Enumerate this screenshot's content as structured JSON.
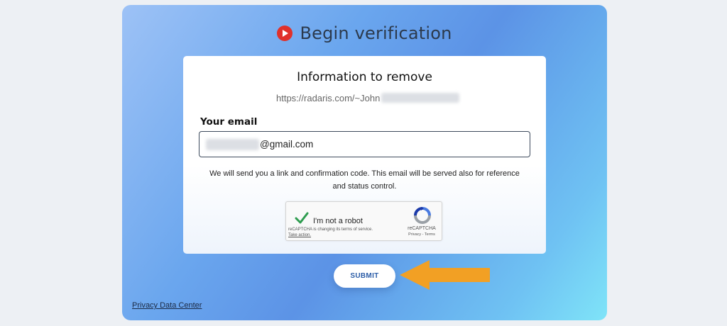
{
  "header": {
    "logo_icon": "radaris-play-logo-icon",
    "title": "Begin verification"
  },
  "card": {
    "heading": "Information to remove",
    "url_prefix": "https://radaris.com/~John"
  },
  "email": {
    "label": "Your email",
    "value_suffix": "@gmail.com"
  },
  "notice": {
    "line1": "We will send you a link and confirmation code. This email will be served also for reference",
    "line2": "and status control."
  },
  "recaptcha": {
    "checkbox_label": "I'm not a robot",
    "checked": true,
    "notice": "reCAPTCHA is changing its terms of service.",
    "take_action": "Take action.",
    "brand": "reCAPTCHA",
    "links": "Privacy - Terms"
  },
  "submit_label": "SUBMIT",
  "footer": {
    "privacy_link": "Privacy Data Center"
  },
  "colors": {
    "accent_arrow": "#f2a024",
    "logo_red": "#e0312b",
    "submit_text": "#2d5ea8"
  }
}
